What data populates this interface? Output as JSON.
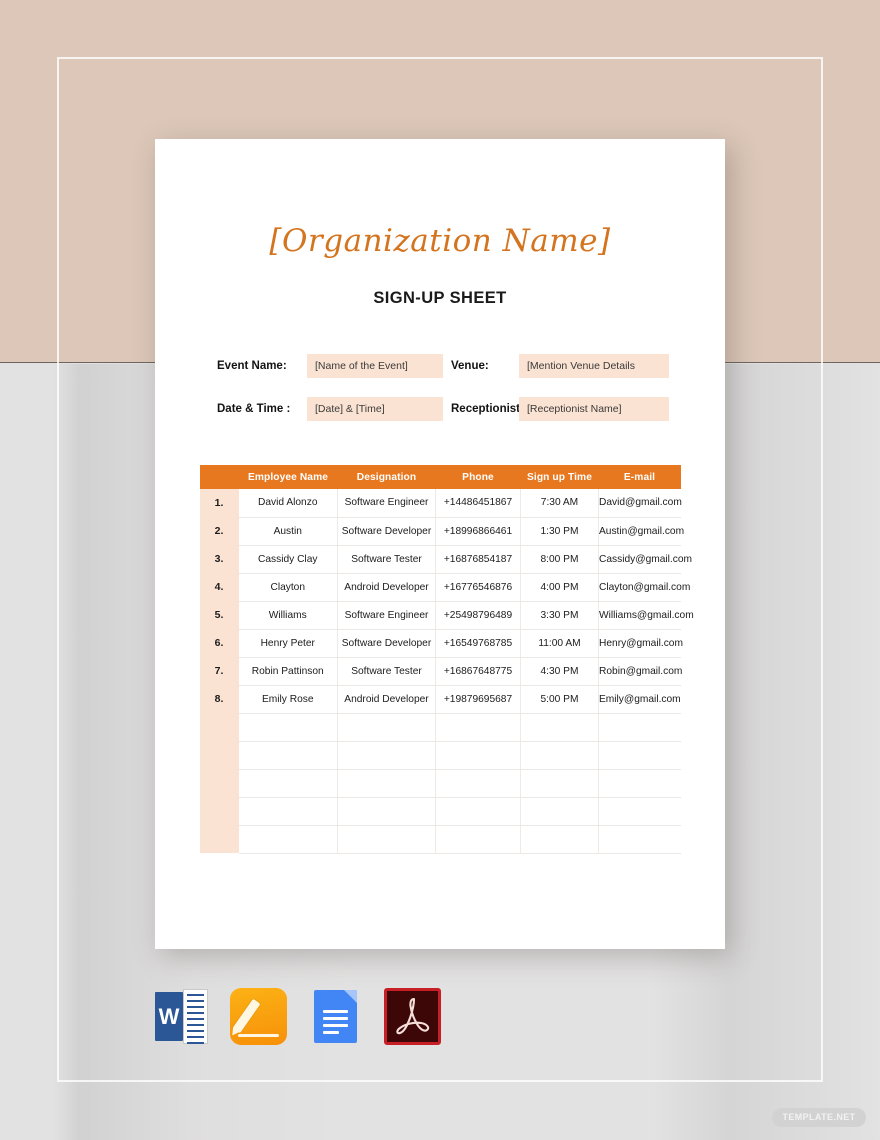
{
  "document": {
    "organization_name": "[Organization Name]",
    "sheet_title": "SIGN-UP SHEET",
    "accent_color": "#e8781f",
    "org_name_color": "#d4741f",
    "field_fill_color": "#fbe3d3"
  },
  "form": {
    "rows": [
      {
        "left": {
          "label": "Event Name:",
          "value": "[Name of the Event]"
        },
        "right": {
          "label": "Venue:",
          "value": "[Mention Venue Details"
        }
      },
      {
        "left": {
          "label": "Date & Time :",
          "value": "[Date] & [Time]"
        },
        "right": {
          "label": "Receptionist:",
          "value": "[Receptionist Name]"
        }
      }
    ]
  },
  "table": {
    "index_header": "",
    "headers": [
      "Employee Name",
      "Designation",
      "Phone",
      "Sign up Time",
      "E-mail"
    ],
    "rows": [
      {
        "index": "1.",
        "name": "David Alonzo",
        "designation": "Software Engineer",
        "phone": "+14486451867",
        "time": "7:30 AM",
        "email": "David@gmail.com"
      },
      {
        "index": "2.",
        "name": "Austin",
        "designation": "Software Developer",
        "phone": "+18996866461",
        "time": "1:30 PM",
        "email": "Austin@gmail.com"
      },
      {
        "index": "3.",
        "name": "Cassidy Clay",
        "designation": "Software Tester",
        "phone": "+16876854187",
        "time": "8:00 PM",
        "email": "Cassidy@gmail.com"
      },
      {
        "index": "4.",
        "name": "Clayton",
        "designation": "Android Developer",
        "phone": "+16776546876",
        "time": "4:00 PM",
        "email": "Clayton@gmail.com"
      },
      {
        "index": "5.",
        "name": "Williams",
        "designation": "Software Engineer",
        "phone": "+25498796489",
        "time": "3:30 PM",
        "email": "Williams@gmail.com"
      },
      {
        "index": "6.",
        "name": "Henry Peter",
        "designation": "Software Developer",
        "phone": "+16549768785",
        "time": "11:00 AM",
        "email": "Henry@gmail.com"
      },
      {
        "index": "7.",
        "name": "Robin Pattinson",
        "designation": "Software Tester",
        "phone": "+16867648775",
        "time": "4:30 PM",
        "email": "Robin@gmail.com"
      },
      {
        "index": "8.",
        "name": "Emily Rose",
        "designation": "Android Developer",
        "phone": "+19879695687",
        "time": "5:00 PM",
        "email": "Emily@gmail.com"
      }
    ],
    "blank_row_count": 5
  },
  "format_icons": [
    {
      "name": "ms-word-icon",
      "label": "W"
    },
    {
      "name": "apple-pages-icon",
      "label": ""
    },
    {
      "name": "google-docs-icon",
      "label": ""
    },
    {
      "name": "adobe-pdf-icon",
      "label": ""
    }
  ],
  "watermark": {
    "label": "TEMPLATE.NET"
  }
}
